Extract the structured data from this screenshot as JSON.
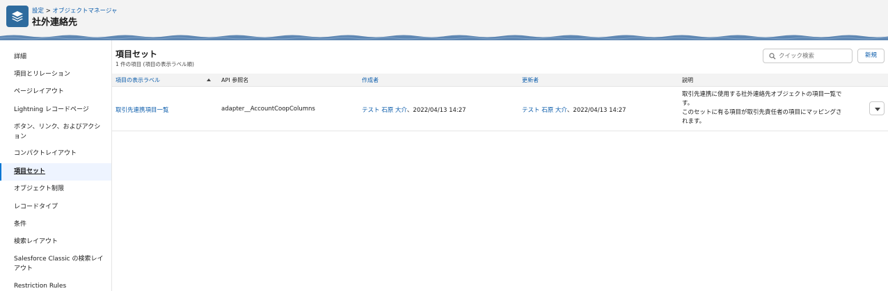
{
  "header": {
    "breadcrumb_setup": "設定",
    "breadcrumb_sep": ">",
    "breadcrumb_object_manager": "オブジェクトマネージャ",
    "title": "社外連絡先",
    "app_icon": "layers-icon"
  },
  "sidebar": {
    "items": [
      {
        "label": "詳細"
      },
      {
        "label": "項目とリレーション"
      },
      {
        "label": "ページレイアウト"
      },
      {
        "label": "Lightning レコードページ"
      },
      {
        "label": "ボタン、リンク、およびアクション"
      },
      {
        "label": "コンパクトレイアウト"
      },
      {
        "label": "項目セット",
        "active": true
      },
      {
        "label": "オブジェクト制限"
      },
      {
        "label": "レコードタイプ"
      },
      {
        "label": "条件"
      },
      {
        "label": "検索レイアウト"
      },
      {
        "label": "Salesforce Classic の検索レイアウト"
      },
      {
        "label": "Restriction Rules"
      }
    ]
  },
  "main": {
    "title": "項目セット",
    "subtitle": "1 件の項目 (項目の表示ラベル順)",
    "search_placeholder": "クイック検索",
    "search_icon": "search-icon",
    "new_button": "新規"
  },
  "table": {
    "columns": [
      "項目の表示ラベル",
      "API 参照名",
      "作成者",
      "更新者",
      "説明"
    ],
    "sort_column": "項目の表示ラベル",
    "sort_direction": "ascending",
    "rows": [
      {
        "label": "取引先連携項目一覧",
        "api_name": "adapter__AccountCoopColumns",
        "created_by": "テスト 石原 大介",
        "created_date": "、2022/04/13 14:27",
        "modified_by": "テスト 石原 大介",
        "modified_date": "、2022/04/13 14:27",
        "description_lines": [
          "取引先連携に使用する社外連絡先オブジェクトの項目一覧で",
          "す。",
          "このセットに有る項目が取引先責任者の項目にマッピングさ",
          "れます。"
        ]
      }
    ]
  },
  "colors": {
    "link": "#0b5cab",
    "brand_band": "#5e87b3",
    "app_icon_bg": "#2e6b9e",
    "header_bg": "#f3f3f3"
  }
}
